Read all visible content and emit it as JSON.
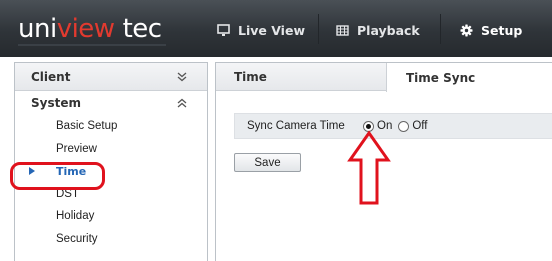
{
  "logo": {
    "part1": "uni",
    "part2": "view",
    "part3": "tec"
  },
  "nav": {
    "live_view": "Live View",
    "playback": "Playback",
    "setup": "Setup"
  },
  "sidebar": {
    "client": "Client",
    "system": "System",
    "items": [
      {
        "label": "Basic Setup"
      },
      {
        "label": "Preview"
      },
      {
        "label": "Time",
        "active": true
      },
      {
        "label": "DST"
      },
      {
        "label": "Holiday"
      },
      {
        "label": "Security"
      }
    ]
  },
  "tabs": {
    "time": "Time",
    "time_sync": "Time Sync"
  },
  "sync": {
    "label": "Sync Camera Time",
    "on": "On",
    "off": "Off",
    "selected": "On"
  },
  "buttons": {
    "save": "Save"
  },
  "colors": {
    "brand_red": "#e23a2f",
    "annotation_red": "#e0121d",
    "active_blue": "#2466b5"
  }
}
